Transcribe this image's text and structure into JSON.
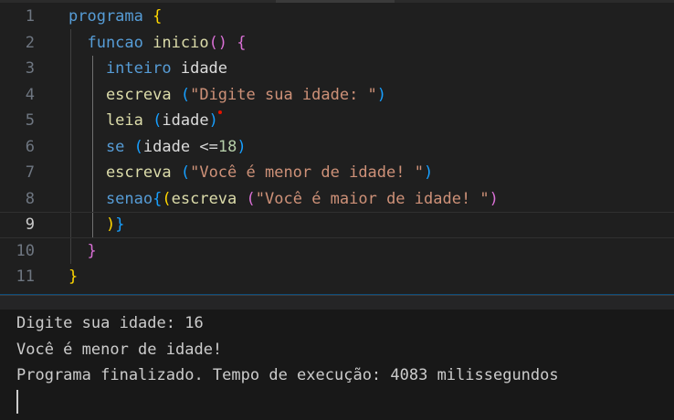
{
  "editor": {
    "line_numbers": [
      "1",
      "2",
      "3",
      "4",
      "5",
      "6",
      "7",
      "8",
      "9",
      "10",
      "11"
    ],
    "lines": [
      [
        {
          "t": "programa",
          "c": "kw"
        },
        {
          "t": " ",
          "c": "op"
        },
        {
          "t": "{",
          "c": "b1"
        }
      ],
      [
        {
          "t": "  funcao",
          "c": "kw"
        },
        {
          "t": " ",
          "c": "op"
        },
        {
          "t": "inicio",
          "c": "fn"
        },
        {
          "t": "()",
          "c": "b2"
        },
        {
          "t": " ",
          "c": "op"
        },
        {
          "t": "{",
          "c": "b2"
        }
      ],
      [
        {
          "t": "    inteiro",
          "c": "kw"
        },
        {
          "t": " ",
          "c": "op"
        },
        {
          "t": "idade",
          "c": "id"
        }
      ],
      [
        {
          "t": "    escreva",
          "c": "fn"
        },
        {
          "t": " ",
          "c": "op"
        },
        {
          "t": "(",
          "c": "b3"
        },
        {
          "t": "\"Digite sua idade: \"",
          "c": "str"
        },
        {
          "t": ")",
          "c": "b3"
        }
      ],
      [
        {
          "t": "    leia",
          "c": "fn"
        },
        {
          "t": " ",
          "c": "op"
        },
        {
          "t": "(",
          "c": "b3"
        },
        {
          "t": "idade",
          "c": "id"
        },
        {
          "t": ")",
          "c": "b3"
        }
      ],
      [
        {
          "t": "    se",
          "c": "kw"
        },
        {
          "t": " ",
          "c": "op"
        },
        {
          "t": "(",
          "c": "b3"
        },
        {
          "t": "idade",
          "c": "id"
        },
        {
          "t": " <=",
          "c": "op"
        },
        {
          "t": "18",
          "c": "num"
        },
        {
          "t": ")",
          "c": "b3"
        }
      ],
      [
        {
          "t": "    escreva",
          "c": "fn"
        },
        {
          "t": " ",
          "c": "op"
        },
        {
          "t": "(",
          "c": "b3"
        },
        {
          "t": "\"Você é menor de idade! \"",
          "c": "str"
        },
        {
          "t": ")",
          "c": "b3"
        }
      ],
      [
        {
          "t": "    senao",
          "c": "kw"
        },
        {
          "t": "{",
          "c": "b3"
        },
        {
          "t": "(",
          "c": "b1"
        },
        {
          "t": "escreva",
          "c": "fn"
        },
        {
          "t": " ",
          "c": "op"
        },
        {
          "t": "(",
          "c": "b2"
        },
        {
          "t": "\"Você é maior de idade! \"",
          "c": "str"
        },
        {
          "t": ")",
          "c": "b2"
        }
      ],
      [
        {
          "t": "    ",
          "c": "op"
        },
        {
          "t": ")",
          "c": "b1"
        },
        {
          "t": "}",
          "c": "b3"
        }
      ],
      [
        {
          "t": "  ",
          "c": "op"
        },
        {
          "t": "}",
          "c": "b2"
        }
      ],
      [
        {
          "t": "}",
          "c": "b1"
        }
      ]
    ],
    "active_line_index": 8
  },
  "terminal": {
    "lines": [
      "Digite sua idade: 16",
      "Você é menor de idade!",
      "Programa finalizado. Tempo de execução: 4083 milissegundos"
    ]
  }
}
